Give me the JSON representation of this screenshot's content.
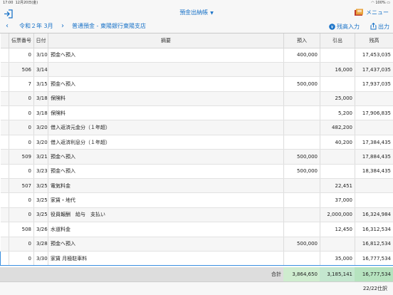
{
  "status_bar": {
    "time": "17:00",
    "date": "12月20日(金)",
    "battery": "100%"
  },
  "nav": {
    "title": "預金出納帳",
    "menu_label": "メニュー"
  },
  "toolbar": {
    "period": "令和２年 3月",
    "account": "普通預金 - 東陽銀行東陽支店",
    "balance_input": "残高入力",
    "output": "出力"
  },
  "table": {
    "headers": {
      "voucher": "伝票番号",
      "date": "日付",
      "description": "摘要",
      "deposit": "預入",
      "withdrawal": "引出",
      "balance": "残高"
    },
    "rows": [
      {
        "voucher": "0",
        "date": "3/10",
        "description": "預金へ預入",
        "deposit": "400,000",
        "withdrawal": "",
        "balance": "17,453,035"
      },
      {
        "voucher": "506",
        "date": "3/14",
        "description": "",
        "deposit": "",
        "withdrawal": "16,000",
        "balance": "17,437,035"
      },
      {
        "voucher": "7",
        "date": "3/15",
        "description": "預金へ預入",
        "deposit": "500,000",
        "withdrawal": "",
        "balance": "17,937,035"
      },
      {
        "voucher": "0",
        "date": "3/18",
        "description": "保険料",
        "deposit": "",
        "withdrawal": "25,000",
        "balance": ""
      },
      {
        "voucher": "0",
        "date": "3/18",
        "description": "保険料",
        "deposit": "",
        "withdrawal": "5,200",
        "balance": "17,906,835"
      },
      {
        "voucher": "0",
        "date": "3/20",
        "description": "借入返済元金分（１年超）",
        "deposit": "",
        "withdrawal": "482,200",
        "balance": ""
      },
      {
        "voucher": "0",
        "date": "3/20",
        "description": "借入返済利息分（１年超）",
        "deposit": "",
        "withdrawal": "40,200",
        "balance": "17,384,435"
      },
      {
        "voucher": "509",
        "date": "3/21",
        "description": "預金へ預入",
        "deposit": "500,000",
        "withdrawal": "",
        "balance": "17,884,435"
      },
      {
        "voucher": "0",
        "date": "3/23",
        "description": "預金へ預入",
        "deposit": "500,000",
        "withdrawal": "",
        "balance": "18,384,435"
      },
      {
        "voucher": "507",
        "date": "3/25",
        "description": "電気料金",
        "deposit": "",
        "withdrawal": "22,451",
        "balance": ""
      },
      {
        "voucher": "0",
        "date": "3/25",
        "description": "家賃・地代",
        "deposit": "",
        "withdrawal": "37,000",
        "balance": ""
      },
      {
        "voucher": "0",
        "date": "3/25",
        "description": "役員報酬　給与　支払い",
        "deposit": "",
        "withdrawal": "2,000,000",
        "balance": "16,324,984"
      },
      {
        "voucher": "508",
        "date": "3/26",
        "description": "水道料金",
        "deposit": "",
        "withdrawal": "12,450",
        "balance": "16,312,534"
      },
      {
        "voucher": "0",
        "date": "3/28",
        "description": "預金へ預入",
        "deposit": "500,000",
        "withdrawal": "",
        "balance": "16,812,534"
      },
      {
        "voucher": "0",
        "date": "3/30",
        "description": "家賃 月極駐車料",
        "deposit": "",
        "withdrawal": "35,000",
        "balance": "16,777,534"
      }
    ]
  },
  "totals": {
    "label": "合計",
    "deposit": "3,864,650",
    "withdrawal": "3,185,141",
    "balance": "16,777,534"
  },
  "footer": {
    "count": "22/22仕訳"
  }
}
